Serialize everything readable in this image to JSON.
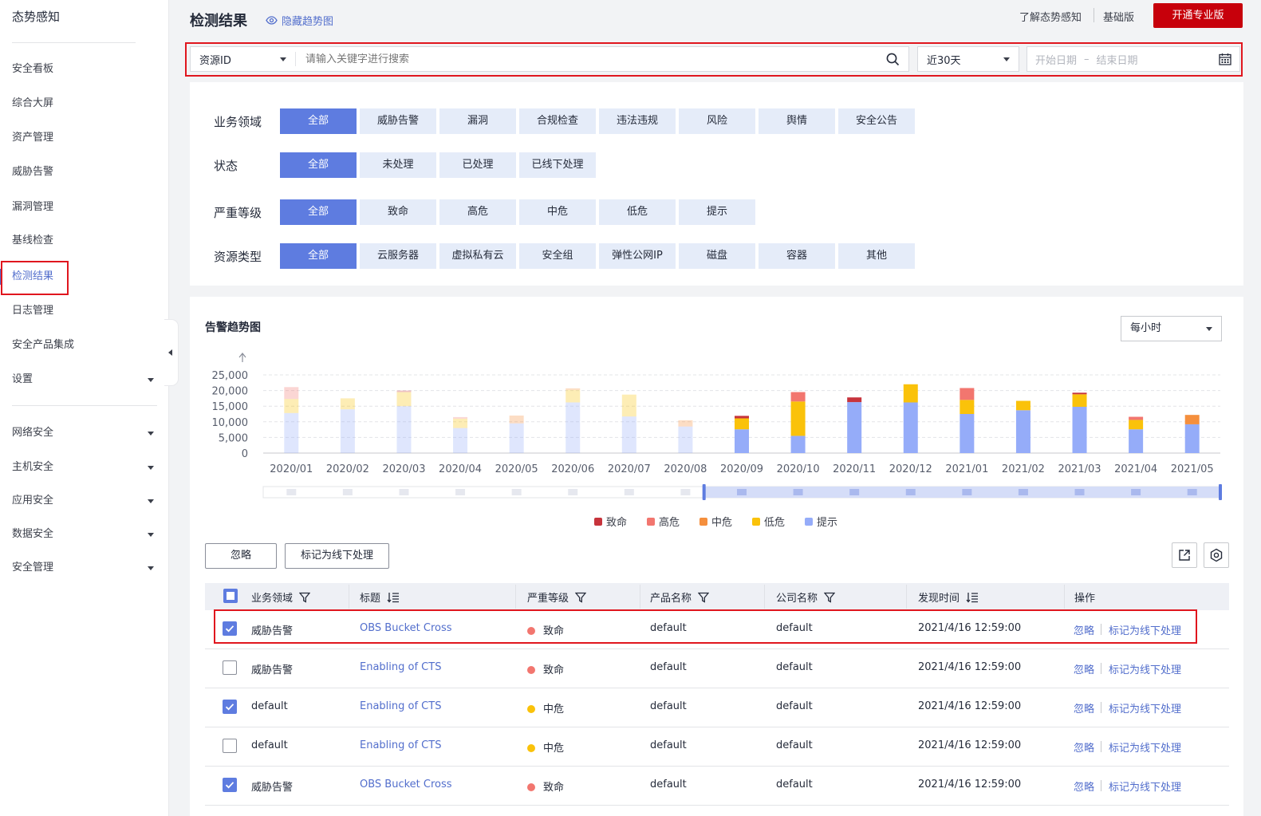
{
  "sidebar": {
    "title": "态势感知",
    "items": [
      "安全看板",
      "综合大屏",
      "资产管理",
      "威胁告警",
      "漏洞管理",
      "基线检查",
      "检测结果",
      "日志管理",
      "安全产品集成",
      "设置"
    ],
    "groups": [
      "网络安全",
      "主机安全",
      "应用安全",
      "数据安全",
      "安全管理"
    ]
  },
  "header": {
    "title": "检测结果",
    "hide_trend": "隐藏趋势图",
    "learn": "了解态势感知",
    "edition": "基础版",
    "upgrade": "开通专业版"
  },
  "search": {
    "type": "资源ID",
    "placeholder": "请输入关键字进行搜索",
    "range": "近30天",
    "start_placeholder": "开始日期",
    "end_placeholder": "结束日期",
    "range_sep": "–"
  },
  "filters": [
    {
      "label": "业务领域",
      "options": [
        "全部",
        "威胁告警",
        "漏洞",
        "合规检查",
        "违法违规",
        "风险",
        "舆情",
        "安全公告"
      ]
    },
    {
      "label": "状态",
      "options": [
        "全部",
        "未处理",
        "已处理",
        "已线下处理"
      ]
    },
    {
      "label": "严重等级",
      "options": [
        "全部",
        "致命",
        "高危",
        "中危",
        "低危",
        "提示"
      ]
    },
    {
      "label": "资源类型",
      "options": [
        "全部",
        "云服务器",
        "虚拟私有云",
        "安全组",
        "弹性公网IP",
        "磁盘",
        "容器",
        "其他"
      ]
    }
  ],
  "trend": {
    "title": "告警趋势图",
    "interval": "每小时"
  },
  "chart_data": {
    "type": "bar",
    "stacked": true,
    "categories": [
      "2020/01",
      "2020/02",
      "2020/03",
      "2020/04",
      "2020/05",
      "2020/06",
      "2020/07",
      "2020/08",
      "2020/09",
      "2020/10",
      "2020/11",
      "2020/12",
      "2021/01",
      "2021/02",
      "2021/03",
      "2021/04",
      "2021/05"
    ],
    "yticks": [
      "0",
      "5,000",
      "10,000",
      "15,000",
      "20,000",
      "25,000"
    ],
    "ylim": [
      0,
      25000
    ],
    "grid": true,
    "legend_position": "bottom",
    "faded_categories_before": "2020/09",
    "series": [
      {
        "name": "致命",
        "color": "#c7343c",
        "values": [
          0,
          0,
          500,
          0,
          0,
          0,
          0,
          0,
          800,
          0,
          1500,
          0,
          0,
          0,
          500,
          0,
          0
        ]
      },
      {
        "name": "高危",
        "color": "#f2766f",
        "values": [
          3800,
          0,
          0,
          500,
          0,
          0,
          0,
          0,
          0,
          3000,
          0,
          0,
          3800,
          0,
          0,
          1000,
          0
        ]
      },
      {
        "name": "中危",
        "color": "#f58f3d",
        "values": [
          0,
          0,
          0,
          0,
          2500,
          500,
          0,
          2000,
          0,
          0,
          0,
          0,
          0,
          0,
          0,
          0,
          3000
        ]
      },
      {
        "name": "低危",
        "color": "#fac20a",
        "values": [
          4500,
          3500,
          4500,
          3000,
          0,
          4000,
          7000,
          0,
          3500,
          11000,
          0,
          5800,
          4500,
          3000,
          4000,
          3000,
          0
        ]
      },
      {
        "name": "提示",
        "color": "#95acf9",
        "values": [
          12800,
          14000,
          15000,
          8000,
          9500,
          16200,
          11700,
          8500,
          7600,
          5500,
          16300,
          16200,
          12500,
          13700,
          14800,
          7600,
          9200
        ]
      }
    ]
  },
  "actions": {
    "ignore": "忽略",
    "mark_offline": "标记为线下处理"
  },
  "table": {
    "columns": [
      "业务领域",
      "标题",
      "严重等级",
      "产品名称",
      "公司名称",
      "发现时间",
      "操作"
    ],
    "rows": [
      {
        "checked": true,
        "domain": "威胁告警",
        "title": "OBS Bucket Cross",
        "severity": "致命",
        "severity_color": "#f2766f",
        "product": "default",
        "company": "default",
        "time": "2021/4/16 12:59:00"
      },
      {
        "checked": false,
        "domain": "威胁告警",
        "title": "Enabling of CTS",
        "severity": "致命",
        "severity_color": "#f2766f",
        "product": "default",
        "company": "default",
        "time": "2021/4/16 12:59:00"
      },
      {
        "checked": true,
        "domain": "default",
        "title": "Enabling of CTS",
        "severity": "中危",
        "severity_color": "#fac20a",
        "product": "default",
        "company": "default",
        "time": "2021/4/16 12:59:00"
      },
      {
        "checked": false,
        "domain": "default",
        "title": "Enabling of CTS",
        "severity": "中危",
        "severity_color": "#fac20a",
        "product": "default",
        "company": "default",
        "time": "2021/4/16 12:59:00"
      },
      {
        "checked": true,
        "domain": "威胁告警",
        "title": "OBS Bucket Cross",
        "severity": "致命",
        "severity_color": "#f2766f",
        "product": "default",
        "company": "default",
        "time": "2021/4/16 12:59:00"
      }
    ],
    "row_op_ignore": "忽略",
    "row_op_mark": "标记为线下处理"
  }
}
